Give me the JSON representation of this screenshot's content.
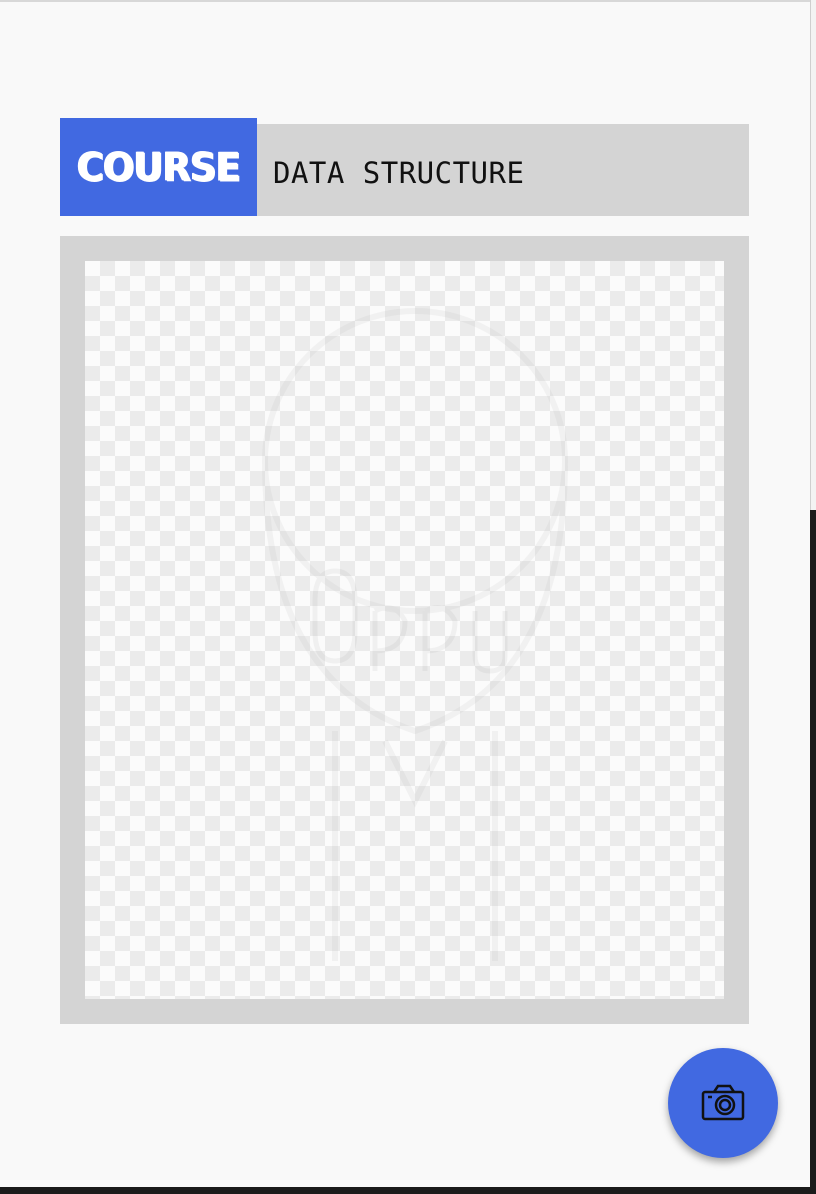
{
  "header": {
    "badge_label": "COURSE",
    "course_name": "DATA STRUCTURE"
  },
  "photo": {
    "icon": "transparent-placeholder-image"
  },
  "fab": {
    "icon": "camera-icon"
  },
  "colors": {
    "accent": "#4169e1",
    "panel": "#d4d4d4",
    "background": "#f9f9f9"
  }
}
